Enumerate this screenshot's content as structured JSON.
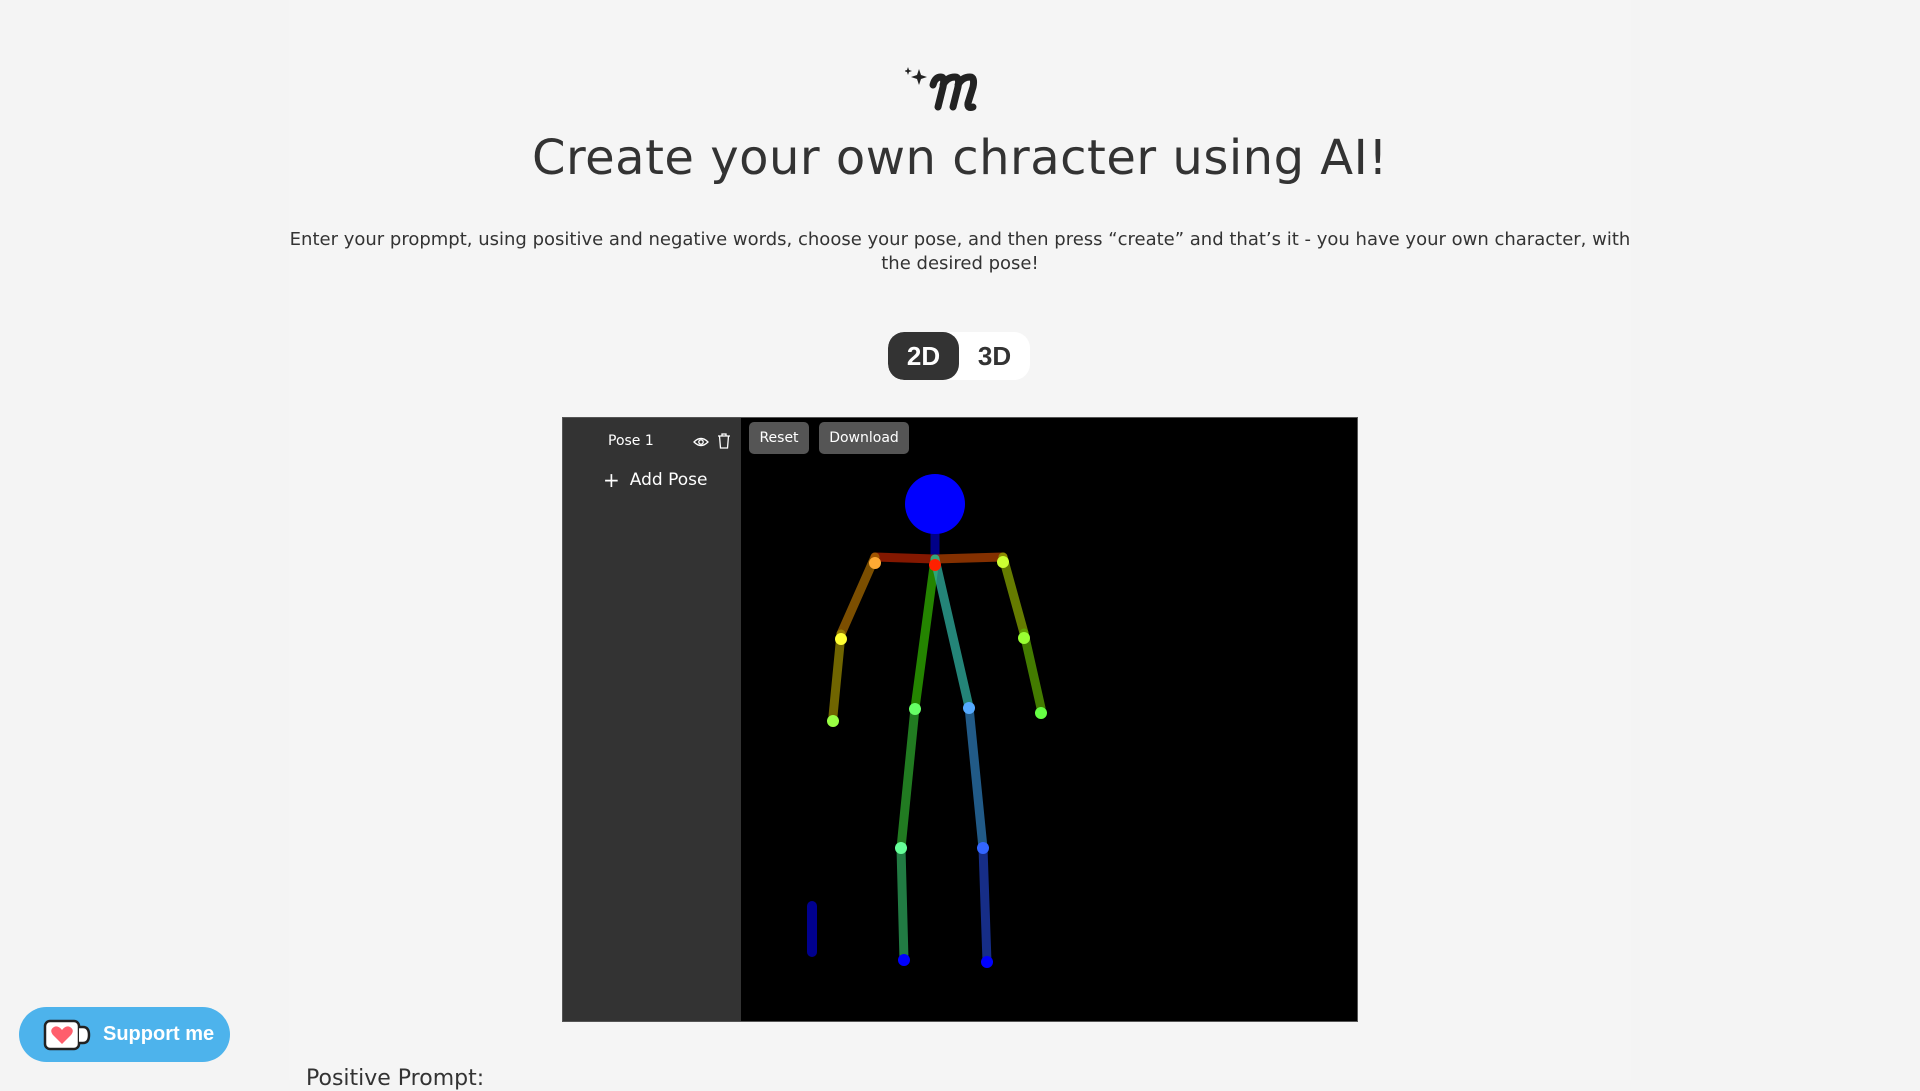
{
  "header": {
    "logo_icon": "sparkle-m-logo",
    "title": "Create your own chracter using AI!",
    "subtitle": "Enter your propmpt, using positive and negative words, choose your pose, and then press “create” and that’s it - you have your own character, with the desired pose!"
  },
  "mode_toggle": {
    "options": [
      "2D",
      "3D"
    ],
    "selected": "2D"
  },
  "editor": {
    "poses": [
      {
        "name": "Pose 1"
      }
    ],
    "add_pose_label": "Add Pose",
    "toolbar": {
      "reset_label": "Reset",
      "download_label": "Download"
    }
  },
  "support": {
    "label": "Support me",
    "icon": "heart-cup-icon"
  },
  "form": {
    "positive_prompt_label": "Positive Prompt:"
  },
  "colors": {
    "accent_dark": "#333333",
    "support_blue": "#4db3ec",
    "canvas_bg": "#000000",
    "head": "#0000ff"
  }
}
